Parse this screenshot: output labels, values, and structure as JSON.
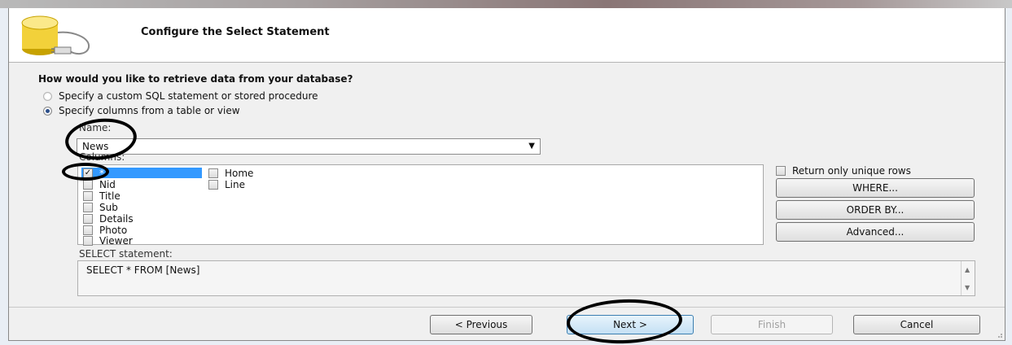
{
  "header": {
    "title": "Configure the Select Statement",
    "icon": "database-icon"
  },
  "question": "How would you like to retrieve data from your database?",
  "options": [
    {
      "label": "Specify a custom SQL statement or stored procedure",
      "selected": false
    },
    {
      "label": "Specify columns from a table or view",
      "selected": true
    }
  ],
  "name_label": "Name:",
  "table_value": "News",
  "columns_label": "Columns:",
  "columns": [
    {
      "label": "*",
      "checked": true
    },
    {
      "label": "Nid",
      "checked": false
    },
    {
      "label": "Title",
      "checked": false
    },
    {
      "label": "Sub",
      "checked": false
    },
    {
      "label": "Details",
      "checked": false
    },
    {
      "label": "Photo",
      "checked": false
    },
    {
      "label": "Viewer",
      "checked": false
    },
    {
      "label": "Home",
      "checked": false
    },
    {
      "label": "Line",
      "checked": false
    }
  ],
  "unique_rows_label": "Return only unique rows",
  "side_buttons": {
    "where": "WHERE...",
    "order_by": "ORDER BY...",
    "advanced": "Advanced..."
  },
  "statement_label": "SELECT statement:",
  "statement": "SELECT * FROM [News]",
  "footer": {
    "previous": "< Previous",
    "next": "Next >",
    "finish": "Finish",
    "cancel": "Cancel"
  },
  "colors": {
    "selection": "#3399ff",
    "annotation": "#000000"
  }
}
